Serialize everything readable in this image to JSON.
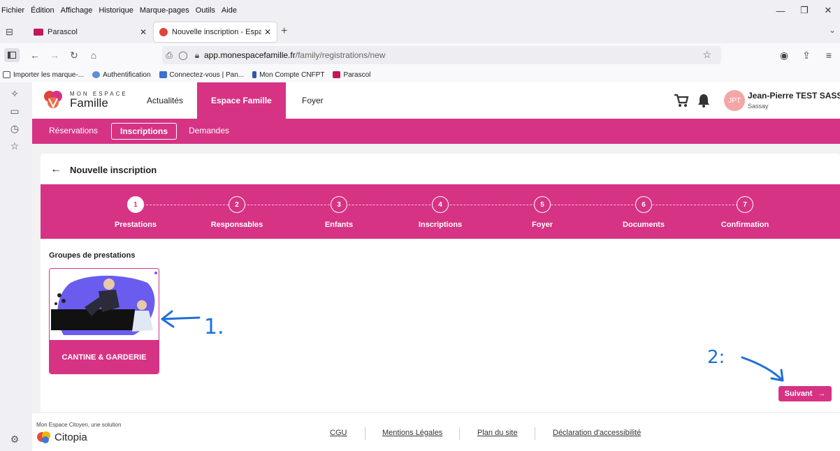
{
  "browser": {
    "menu": [
      "Fichier",
      "Édition",
      "Affichage",
      "Historique",
      "Marque-pages",
      "Outils",
      "Aide"
    ],
    "tabs": [
      {
        "label": "Parascol",
        "active": false,
        "favicon_color": "#c2185b"
      },
      {
        "label": "Nouvelle inscription - Espace Fa",
        "active": true,
        "favicon_color": "#e0433c"
      }
    ],
    "url": {
      "host": "app.monespacefamille.fr",
      "path": "/family/registrations/new"
    },
    "bookmarks": [
      {
        "label": "Importer les marque-...",
        "icon": "import-icon"
      },
      {
        "label": "Authentification",
        "icon": "auth-icon"
      },
      {
        "label": "Connectez-vous | Pan...",
        "icon": "shield-icon"
      },
      {
        "label": "Mon Compte CNFPT",
        "icon": "cnfpt-icon"
      },
      {
        "label": "Parascol",
        "icon": "parascol-icon"
      }
    ]
  },
  "app": {
    "logo": {
      "small": "MON ESPACE",
      "big": "Famille"
    },
    "topnav": [
      "Actualités",
      "Espace Famille",
      "Foyer"
    ],
    "user": {
      "initials": "JPT",
      "name": "Jean-Pierre TEST SASSAY",
      "sub": "Sassay"
    },
    "subnav": [
      "Réservations",
      "Inscriptions",
      "Demandes"
    ],
    "page_title": "Nouvelle inscription",
    "steps": [
      {
        "num": "1",
        "label": "Prestations"
      },
      {
        "num": "2",
        "label": "Responsables"
      },
      {
        "num": "3",
        "label": "Enfants"
      },
      {
        "num": "4",
        "label": "Inscriptions"
      },
      {
        "num": "5",
        "label": "Foyer"
      },
      {
        "num": "6",
        "label": "Documents"
      },
      {
        "num": "7",
        "label": "Confirmation"
      }
    ],
    "group_title": "Groupes de prestations",
    "tile_label": "CANTINE & GARDERIE",
    "next_label": "Suivant",
    "footer": {
      "tagline": "Mon Espace Citoyen, une solution",
      "brand": "Citopia",
      "links": [
        "CGU",
        "Mentions Légales",
        "Plan du site",
        "Déclaration d'accessibilité"
      ]
    }
  },
  "annotations": {
    "label_1": "1.",
    "label_2": "2:",
    "color": "#1e6fd9"
  },
  "colors": {
    "accent": "#d63384"
  }
}
